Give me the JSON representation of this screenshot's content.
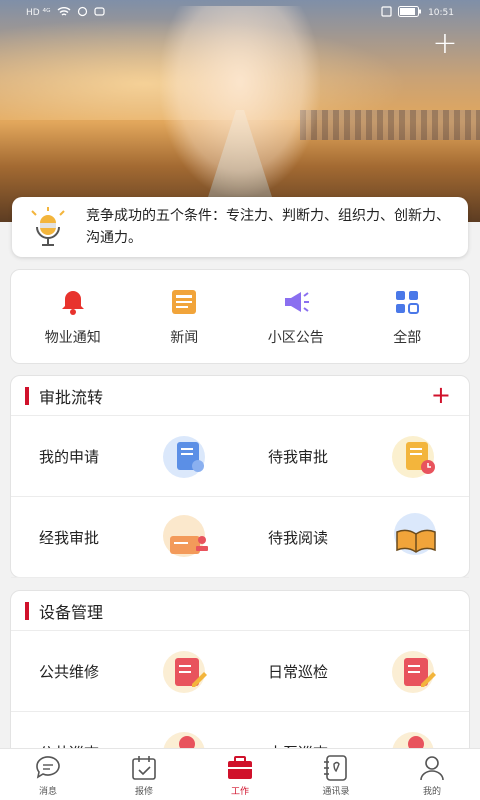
{
  "status_bar": {
    "left_indicators": "HD ⁴ᴳ",
    "time": "10:51"
  },
  "notice": {
    "text": "竞争成功的五个条件：专注力、判断力、组织力、创新力、沟通力。"
  },
  "quick_menu": [
    {
      "label": "物业通知",
      "icon": "bell-icon",
      "color": "#e8332d"
    },
    {
      "label": "新闻",
      "icon": "newspaper-icon",
      "color": "#f1a43a"
    },
    {
      "label": "小区公告",
      "icon": "megaphone-icon",
      "color": "#8a6ff0"
    },
    {
      "label": "全部",
      "icon": "grid-icon",
      "color": "#4a78e8"
    }
  ],
  "approval": {
    "title": "审批流转",
    "items": [
      {
        "label": "我的申请",
        "icon": "application-icon"
      },
      {
        "label": "待我审批",
        "icon": "pending-approval-icon"
      },
      {
        "label": "经我审批",
        "icon": "approved-icon"
      },
      {
        "label": "待我阅读",
        "icon": "book-icon"
      }
    ]
  },
  "equipment": {
    "title": "设备管理",
    "items": [
      {
        "label": "公共维修",
        "icon": "edit-document-icon"
      },
      {
        "label": "日常巡检",
        "icon": "edit-document-icon"
      },
      {
        "label": "公共巡查",
        "icon": "inspection-icon"
      },
      {
        "label": "水泵巡查",
        "icon": "inspection-icon"
      }
    ]
  },
  "tabs": [
    {
      "label": "消息",
      "icon": "message-icon"
    },
    {
      "label": "报修",
      "icon": "calendar-check-icon"
    },
    {
      "label": "工作",
      "icon": "briefcase-icon",
      "active": true
    },
    {
      "label": "通讯录",
      "icon": "contacts-icon"
    },
    {
      "label": "我的",
      "icon": "person-icon"
    }
  ],
  "colors": {
    "accent": "#d0112b"
  }
}
